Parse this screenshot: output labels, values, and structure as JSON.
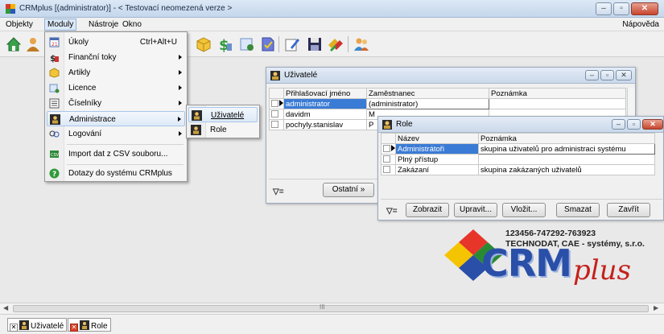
{
  "window": {
    "title": "CRMplus [(administrator)] - < Testovací neomezená verze >"
  },
  "menubar": {
    "items": [
      "Objekty",
      "Moduly",
      "Nástroje",
      "Okno"
    ],
    "help": "Nápověda"
  },
  "modules_menu": {
    "items": [
      {
        "label": "Úkoly",
        "shortcut": "Ctrl+Alt+U",
        "icon": "calendar-icon"
      },
      {
        "label": "Finanční toky",
        "icon": "money-icon",
        "submenu": true
      },
      {
        "label": "Artikly",
        "icon": "box-icon",
        "submenu": true
      },
      {
        "label": "Licence",
        "icon": "license-icon",
        "submenu": true
      },
      {
        "label": "Číselníky",
        "icon": "list-icon",
        "submenu": true
      },
      {
        "label": "Administrace",
        "icon": "admin-users-icon",
        "submenu": true
      },
      {
        "label": "Logování",
        "icon": "log-icon",
        "submenu": true
      },
      {
        "label": "Import dat z CSV souboru...",
        "icon": "csv-icon"
      },
      {
        "label": "Dotazy do systému CRMplus",
        "icon": "help-icon"
      }
    ]
  },
  "admin_submenu": {
    "items": [
      "Uživatelé",
      "Role"
    ]
  },
  "users_window": {
    "title": "Uživatelé",
    "columns": [
      "Přihlašovací jméno",
      "Zaměstnanec",
      "Poznámka"
    ],
    "rows": [
      [
        "administrator",
        "(administrator)",
        ""
      ],
      [
        "davidm",
        "M",
        ""
      ],
      [
        "pochyly.stanislav",
        "P",
        ""
      ]
    ],
    "filter_label": "▽=",
    "other_button": "Ostatní »"
  },
  "role_window": {
    "title": "Role",
    "columns": [
      "Název",
      "Poznámka"
    ],
    "rows": [
      [
        "Administrátoři",
        "skupina uživatelů pro administraci systému"
      ],
      [
        "Plný přístup",
        ""
      ],
      [
        "Zakázaní",
        "skupina zakázaných uživatelů"
      ]
    ],
    "filter_label": "▽=",
    "buttons": [
      "Zobrazit",
      "Upravit...",
      "Vložit...",
      "Smazat",
      "Zavřít"
    ]
  },
  "company": {
    "phone": "123456-747292-763923",
    "name": "TECHNODAT, CAE - systémy, s.r.o.",
    "logo_text_1": "CRM",
    "logo_text_2": "plus"
  },
  "taskbar": {
    "tabs": [
      "Uživatelé",
      "Role"
    ]
  },
  "scrollbar": {
    "grip": "III"
  },
  "colors": {
    "selection": "#3a7bd5",
    "logo_blue": "#2a4fa8",
    "logo_red": "#c4211b"
  }
}
